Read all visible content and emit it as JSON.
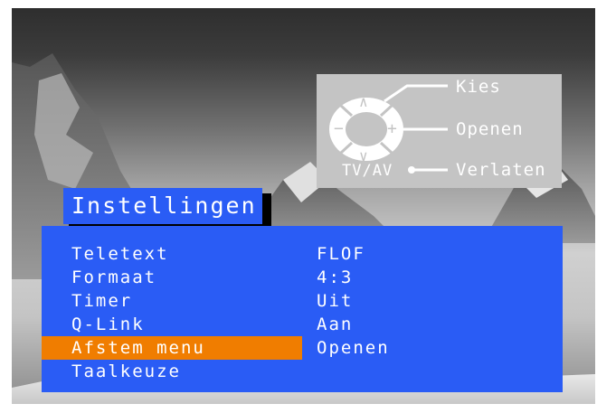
{
  "help": {
    "kies": "Kies",
    "openen": "Openen",
    "verlaten": "Verlaten",
    "tvav": "TV/AV",
    "up_glyph": "∧",
    "down_glyph": "∨",
    "minus_glyph": "−",
    "plus_glyph": "+"
  },
  "menu": {
    "title": "Instellingen",
    "selected_index": 4,
    "items": [
      {
        "label": "Teletext",
        "value": "FLOF"
      },
      {
        "label": "Formaat",
        "value": "4:3"
      },
      {
        "label": "Timer",
        "value": "Uit"
      },
      {
        "label": "Q-Link",
        "value": "Aan"
      },
      {
        "label": "Afstem menu",
        "value": "Openen"
      },
      {
        "label": "Taalkeuze",
        "value": ""
      }
    ]
  },
  "colors": {
    "panel_blue": "#2a5cf5",
    "highlight_orange": "#f07d00",
    "help_grey": "#c4c4c4",
    "text": "#ffffff"
  }
}
